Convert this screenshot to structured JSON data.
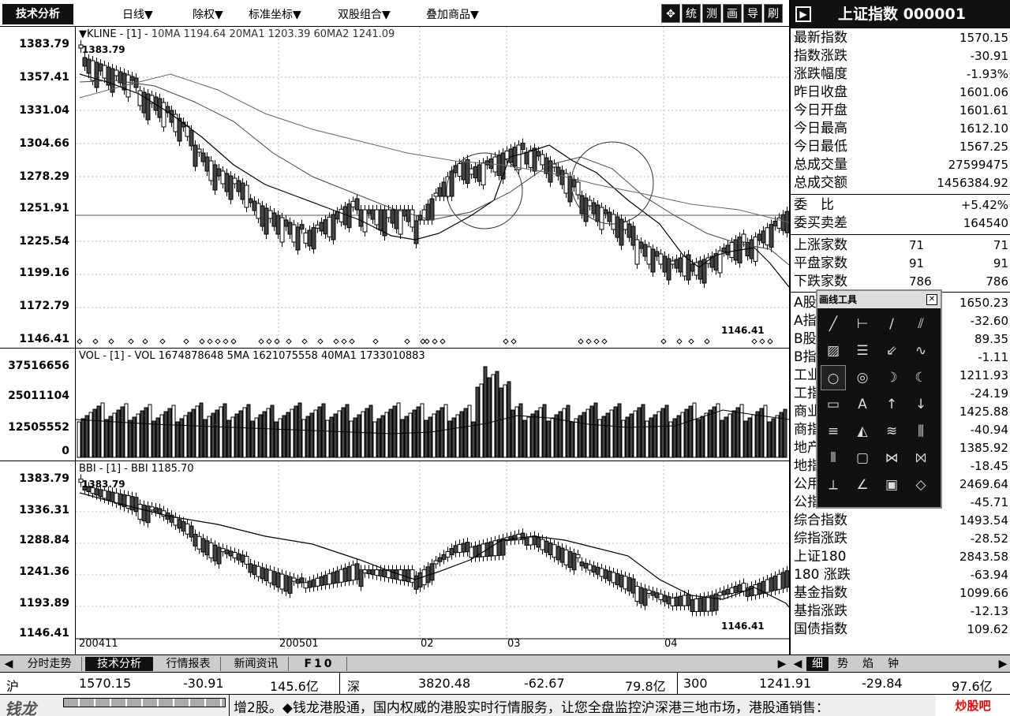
{
  "toolbar": {
    "tech_tab": "技术分析",
    "menus": [
      "日线▼",
      "除权▼",
      "标准坐标▼",
      "双股组合▼",
      "叠加商品▼"
    ],
    "buttons": [
      "✥",
      "统",
      "测",
      "画",
      "导",
      "刷"
    ]
  },
  "kline": {
    "title": "▼KLINE - [1] - ",
    "ma": "10MA 1194.64  20MA1 1203.39  60MA2 1241.09",
    "y_labels": [
      "1383.79",
      "1357.41",
      "1331.04",
      "1304.66",
      "1278.29",
      "1251.91",
      "1225.54",
      "1199.16",
      "1172.79",
      "1146.41"
    ],
    "hi_label": "1383.79",
    "lo_label": "1146.41"
  },
  "vol": {
    "title": "VOL - [1] - ",
    "line": "VOL 1674878648  5MA 1621075558  40MA1 1733010883",
    "y_labels": [
      "37516656",
      "25011104",
      "12505552",
      "0"
    ]
  },
  "bbi": {
    "title": "BBI - [1] - ",
    "line": "BBI 1185.70",
    "y_labels": [
      "1383.79",
      "1336.31",
      "1288.84",
      "1241.36",
      "1193.89",
      "1146.41"
    ],
    "hi_label": "1383.79",
    "lo_label": "1146.41"
  },
  "x_labels": [
    "200411",
    "200501",
    "02",
    "03",
    "04"
  ],
  "info": {
    "title": "上证指数 000001",
    "rows_a": [
      {
        "k": "最新指数",
        "v": "1570.15"
      },
      {
        "k": "指数涨跌",
        "v": "-30.91"
      },
      {
        "k": "涨跌幅度",
        "v": "-1.93%"
      },
      {
        "k": "昨日收盘",
        "v": "1601.06"
      },
      {
        "k": "今日开盘",
        "v": "1601.61"
      },
      {
        "k": "今日最高",
        "v": "1612.10"
      },
      {
        "k": "今日最低",
        "v": "1567.25"
      },
      {
        "k": "总成交量",
        "v": "27599475"
      },
      {
        "k": "总成交额",
        "v": "1456384.92"
      }
    ],
    "rows_b": [
      {
        "k": "委　比",
        "v": "+5.42%"
      },
      {
        "k": "委买卖差",
        "v": "164540"
      }
    ],
    "rows_c": [
      {
        "k": "上涨家数",
        "m": "71",
        "v": "71"
      },
      {
        "k": "平盘家数",
        "m": "91",
        "v": "91"
      },
      {
        "k": "下跌家数",
        "m": "786",
        "v": "786"
      }
    ],
    "rows_d": [
      {
        "k": "A股指数",
        "v": "1650.23"
      },
      {
        "k": "A指涨跌",
        "v": "-32.60"
      },
      {
        "k": "B股指数",
        "v": "89.35"
      },
      {
        "k": "B指涨跌",
        "v": "-1.11"
      },
      {
        "k": "工业指数",
        "v": "1211.93"
      },
      {
        "k": "工指涨跌",
        "v": "-24.19"
      },
      {
        "k": "商业指数",
        "v": "1425.88"
      },
      {
        "k": "商指涨跌",
        "v": "-40.94"
      },
      {
        "k": "地产指数",
        "v": "1385.92"
      },
      {
        "k": "地指涨跌",
        "v": "-18.45"
      },
      {
        "k": "公用指数",
        "v": "2469.64"
      },
      {
        "k": "公指涨跌",
        "v": "-45.71"
      },
      {
        "k": "综合指数",
        "v": "1493.54"
      },
      {
        "k": "综指涨跌",
        "v": "-28.52"
      },
      {
        "k": "上证180",
        "v": "2843.58"
      },
      {
        "k": "180 涨跌",
        "v": "-63.94"
      },
      {
        "k": "基金指数",
        "v": "1099.66"
      },
      {
        "k": "基指涨跌",
        "v": "-12.13"
      },
      {
        "k": "国债指数",
        "v": "109.62"
      }
    ]
  },
  "tools": {
    "title": "画线工具",
    "close": "✕",
    "icons": [
      "╱",
      "⊢",
      "∕",
      "⫽",
      "▨",
      "☰",
      "⇙",
      "∿",
      "○",
      "◎",
      "☽",
      "☾",
      "▭",
      "Α",
      "↑",
      "↓",
      "≡",
      "◭",
      "≋",
      "⫼",
      "⦀",
      "▢",
      "⋈",
      "⨝",
      "⟂",
      "∠",
      "▣",
      "◇"
    ]
  },
  "tabs": [
    "分时走势",
    "技术分析",
    "行情报表",
    "新闻资讯",
    "F10"
  ],
  "rtabs": [
    "细",
    "势",
    "焰",
    "钟"
  ],
  "status": {
    "sh_label": "沪",
    "sh_price": "1570.15",
    "sh_chg": "-30.91",
    "sh_amt": "145.6亿",
    "sz_label": "深",
    "sz_price": "3820.48",
    "sz_chg": "-62.67",
    "sz_amt": "79.8亿",
    "i300_label": "300",
    "i300_price": "1241.91",
    "i300_chg": "-29.84",
    "i300_amt": "97.6亿"
  },
  "ticker": {
    "text": "增2股。◆钱龙港股通，国内权威的港股实时行情服务，让您全盘监控沪深港三地市场，港股通销售：",
    "logo": "钱龙",
    "watermark": "炒股吧"
  }
}
